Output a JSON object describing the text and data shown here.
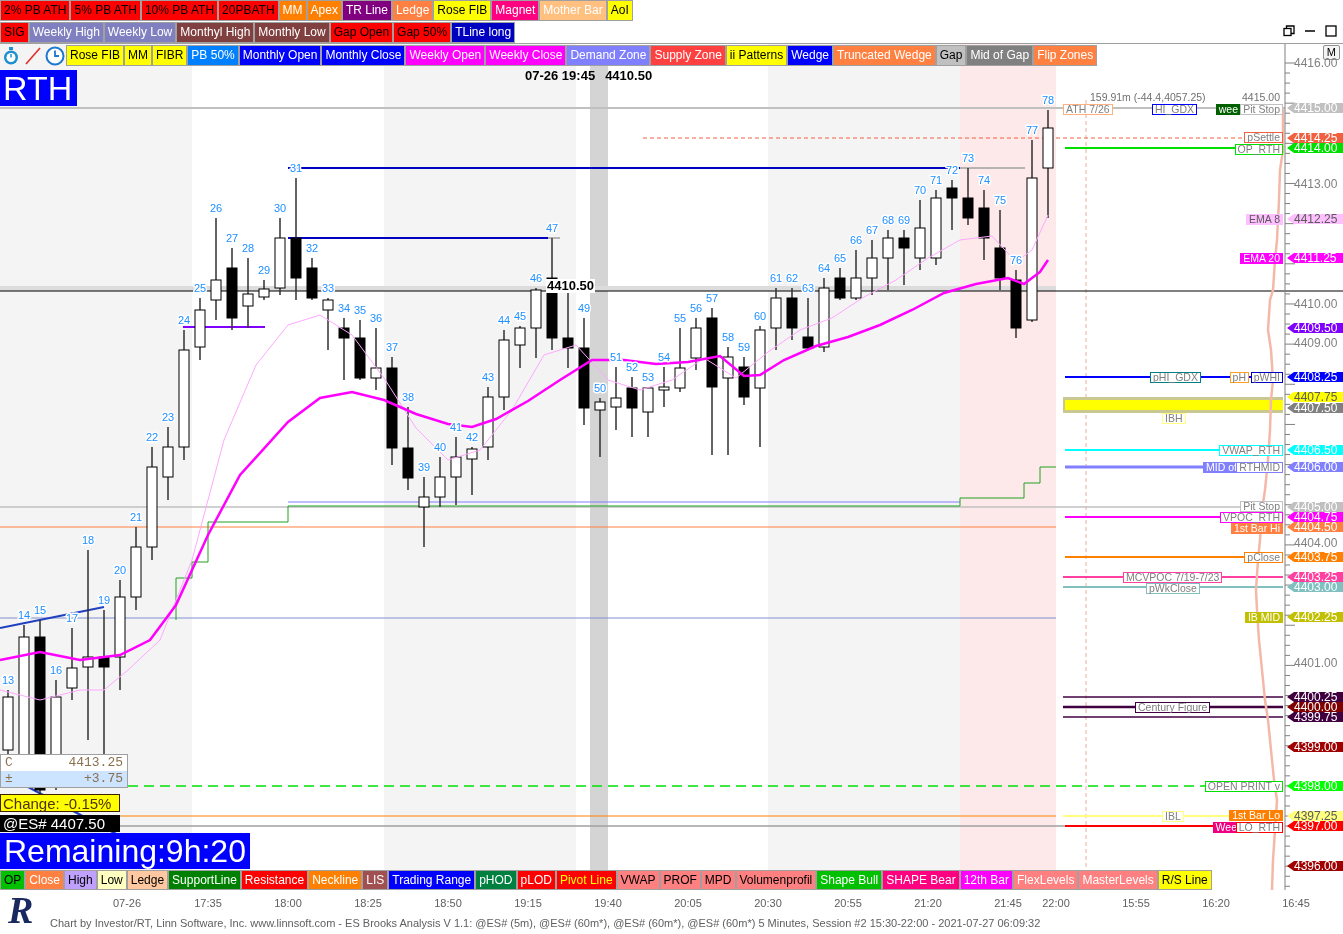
{
  "toolbar_rows": [
    {
      "buttons": [
        {
          "label": "2% PB ATH",
          "color": "#ff0000",
          "kind": "dark"
        },
        {
          "label": "5% PB ATH",
          "color": "#ff0000",
          "kind": "dark"
        },
        {
          "label": "10% PB ATH",
          "color": "#ff0000",
          "kind": "dark"
        },
        {
          "label": "20PBATH",
          "color": "#ff0000",
          "kind": "dark"
        },
        {
          "label": "MM",
          "color": "#ff8000",
          "kind": "light"
        },
        {
          "label": "Apex",
          "color": "#ff8000",
          "kind": "light"
        },
        {
          "label": "TR Line",
          "color": "#800080",
          "kind": "light"
        },
        {
          "label": "Ledge",
          "color": "#ff8040",
          "kind": "light"
        },
        {
          "label": "Rose FIB",
          "color": "#ffff00",
          "kind": "dark"
        },
        {
          "label": "Magnet",
          "color": "#ff0080",
          "kind": "light"
        },
        {
          "label": "Mother Bar",
          "color": "#ffc080",
          "kind": "light"
        },
        {
          "label": "AoI",
          "color": "#ffff00",
          "kind": "dark"
        }
      ]
    },
    {
      "buttons": [
        {
          "label": "SIG",
          "color": "#ff0000",
          "kind": "dark"
        },
        {
          "label": "Weekly High",
          "color": "#8080c0",
          "kind": "light"
        },
        {
          "label": "Weekly Low",
          "color": "#8080c0",
          "kind": "light"
        },
        {
          "label": "Monthyl High",
          "color": "#804040",
          "kind": "light"
        },
        {
          "label": "Monthly Low",
          "color": "#804040",
          "kind": "light"
        },
        {
          "label": "Gap Open",
          "color": "#ff0000",
          "kind": "dark"
        },
        {
          "label": "Gap 50%",
          "color": "#ff0000",
          "kind": "dark"
        },
        {
          "label": "TLine long",
          "color": "#0000c0",
          "kind": "light"
        }
      ]
    }
  ],
  "chart": {
    "tools": [
      {
        "label": "Rose FIB",
        "color": "#ffff00",
        "kind": "dark"
      },
      {
        "label": "MM",
        "color": "#ffff00",
        "kind": "dark"
      },
      {
        "label": "FIBR",
        "color": "#ffff00",
        "kind": "dark"
      },
      {
        "label": "PB 50%",
        "color": "#0080ff",
        "kind": "light"
      },
      {
        "label": "Monthly Open",
        "color": "#0000ff",
        "kind": "light"
      },
      {
        "label": "Monthly Close",
        "color": "#0000ff",
        "kind": "light"
      },
      {
        "label": "Weekly Open",
        "color": "#ff00ff",
        "kind": "light"
      },
      {
        "label": "Weekly Close",
        "color": "#ff00ff",
        "kind": "light"
      },
      {
        "label": "Demand Zone",
        "color": "#8080ff",
        "kind": "light"
      },
      {
        "label": "Supply Zone",
        "color": "#ff4040",
        "kind": "light"
      },
      {
        "label": "ii Patterns",
        "color": "#ffff00",
        "kind": "dark"
      },
      {
        "label": "Wedge",
        "color": "#0000ff",
        "kind": "light"
      },
      {
        "label": "Truncated Wedge",
        "color": "#ff8040",
        "kind": "light"
      },
      {
        "label": "Gap",
        "color": "#c0c0c0",
        "kind": "dark"
      },
      {
        "label": "Mid of Gap",
        "color": "#808080",
        "kind": "light"
      },
      {
        "label": "Flip Zones",
        "color": "#ff8040",
        "kind": "light"
      }
    ],
    "menu_button": "M",
    "session_label": "RTH",
    "cursor_readout": {
      "time": "07-26 19:45",
      "price": "4410.50"
    },
    "cursor_price": "4410.50",
    "bar_numbers": [
      "13",
      "14",
      "15",
      "16",
      "17",
      "18",
      "19",
      "20",
      "21",
      "22",
      "23",
      "24",
      "25",
      "26",
      "27",
      "28",
      "29",
      "30",
      "31",
      "32",
      "33",
      "34",
      "35",
      "36",
      "37",
      "38",
      "39",
      "40",
      "41",
      "42",
      "43",
      "44",
      "45",
      "46",
      "47",
      "49",
      "50",
      "51",
      "52",
      "53",
      "54",
      "55",
      "56",
      "57",
      "58",
      "59",
      "60",
      "61",
      "62",
      "63",
      "64",
      "65",
      "66",
      "67",
      "68",
      "69",
      "70",
      "71",
      "72",
      "73",
      "74",
      "75",
      "76",
      "77",
      "78"
    ],
    "level_labels": [
      {
        "text": "159.91m (-44.4,4057.25)",
        "kind": "note"
      },
      {
        "text": "4415.00",
        "kind": "note"
      },
      {
        "text": "ATH 7/26",
        "kind": "outlined",
        "color": "#ffb080"
      },
      {
        "text": "HI_GDX",
        "kind": "outlined",
        "color": "#0000ff"
      },
      {
        "text": "wee",
        "kind": "filled",
        "color": "#006000"
      },
      {
        "text": "Pit Stop",
        "kind": "outlined",
        "color": "#c0c0c0"
      },
      {
        "text": "pSettle",
        "kind": "outlined",
        "color": "#f06040"
      },
      {
        "text": "OP_RTH",
        "kind": "outlined",
        "color": "#00e000"
      },
      {
        "text": "EMA 8",
        "kind": "filled",
        "color": "#ffc0ff"
      },
      {
        "text": "EMA 20",
        "kind": "filled",
        "color": "#ff00ff"
      },
      {
        "text": "pHI_GDX",
        "kind": "outlined",
        "color": "#008080"
      },
      {
        "text": "pH",
        "kind": "outlined",
        "color": "#ffa020"
      },
      {
        "text": "pWHI",
        "kind": "outlined",
        "color": "#0000c0"
      },
      {
        "text": "IBH",
        "kind": "outlined",
        "color": "#ffff80"
      },
      {
        "text": "VWAP_RTH",
        "kind": "outlined",
        "color": "#00ffff"
      },
      {
        "text": "MID of",
        "kind": "filled",
        "color": "#8080ff"
      },
      {
        "text": "RTHMID",
        "kind": "outlined",
        "color": "#8080ff"
      },
      {
        "text": "Pit Stop",
        "kind": "outlined",
        "color": "#c0c0c0"
      },
      {
        "text": "VPOC_RTH",
        "kind": "outlined",
        "color": "#ff00ff"
      },
      {
        "text": "1st Bar Hi",
        "kind": "filled",
        "color": "#ff8040"
      },
      {
        "text": "pClose",
        "kind": "outlined",
        "color": "#ff8000"
      },
      {
        "text": "MCVPOC 7/19-7/23",
        "kind": "outlined",
        "color": "#ff40a0"
      },
      {
        "text": "pWkClose",
        "kind": "outlined",
        "color": "#80c0c0"
      },
      {
        "text": "IB MID",
        "kind": "filled",
        "color": "#c0c000"
      },
      {
        "text": "Century Figure",
        "kind": "outlined",
        "color": "#400040"
      },
      {
        "text": "OPEN PRINT v",
        "kind": "outlined",
        "color": "#00e000"
      },
      {
        "text": "IBL",
        "kind": "outlined",
        "color": "#ffff80"
      },
      {
        "text": "1st Bar Lo",
        "kind": "filled",
        "color": "#ff8000"
      },
      {
        "text": "Wee",
        "kind": "filled",
        "color": "#f00080"
      },
      {
        "text": "LO_RTH",
        "kind": "outlined",
        "color": "#ff0000"
      }
    ],
    "axis_ticks": [
      "4416.00",
      "4413.00",
      "4410.00",
      "4409.00",
      "4404.00",
      "4401.00"
    ],
    "price_tags": [
      {
        "price": "4415.00",
        "color": "#c0c0c0"
      },
      {
        "price": "4414.25",
        "color": "#f06040"
      },
      {
        "price": "4414.00",
        "color": "#00e000"
      },
      {
        "price": "4412.25",
        "color": "#ffc0ff"
      },
      {
        "price": "4411.25",
        "color": "#ff00ff"
      },
      {
        "price": "4409.50",
        "color": "#8000ff"
      },
      {
        "price": "4408.25",
        "color": "#0000ff"
      },
      {
        "price": "4407.75",
        "color": "#ffff00"
      },
      {
        "price": "4407.50",
        "color": "#808080"
      },
      {
        "price": "4406.50",
        "color": "#00ffff"
      },
      {
        "price": "4406.00",
        "color": "#8080ff"
      },
      {
        "price": "4405.00",
        "color": "#c0c0c0"
      },
      {
        "price": "4404.75",
        "color": "#ff00ff"
      },
      {
        "price": "4404.50",
        "color": "#ff8040"
      },
      {
        "price": "4403.75",
        "color": "#ff8000"
      },
      {
        "price": "4403.25",
        "color": "#ff40a0"
      },
      {
        "price": "4403.00",
        "color": "#80c0c0"
      },
      {
        "price": "4402.25",
        "color": "#c0c000"
      },
      {
        "price": "4400.25",
        "color": "#400040"
      },
      {
        "price": "4400.00",
        "color": "#800000"
      },
      {
        "price": "4399.75",
        "color": "#400040"
      },
      {
        "price": "4399.00",
        "color": "#a00000"
      },
      {
        "price": "4398.00",
        "color": "#00ff00"
      },
      {
        "price": "4397.25",
        "color": "#ffff80"
      },
      {
        "price": "4397.00",
        "color": "#ff0000"
      },
      {
        "price": "4396.00",
        "color": "#a00000"
      }
    ],
    "quote_box": [
      {
        "label": "C",
        "value": "4413.25",
        "selected": false
      },
      {
        "label": "±",
        "value": "+3.75",
        "selected": true
      }
    ],
    "change": "Change: -0.15%",
    "last_price": "@ES# 4407.50",
    "remaining": "Remaining:9h:20",
    "bottom_tools": [
      {
        "label": "OP",
        "color": "#00c000",
        "kind": "dark"
      },
      {
        "label": "Close",
        "color": "#ff8040",
        "kind": "light"
      },
      {
        "label": "High",
        "color": "#c0a0ff",
        "kind": "dark"
      },
      {
        "label": "Low",
        "color": "#ffffc0",
        "kind": "dark"
      },
      {
        "label": "Ledge",
        "color": "#ffc8a0",
        "kind": "dark"
      },
      {
        "label": "SupportLine",
        "color": "#008000",
        "kind": "light"
      },
      {
        "label": "Resistance",
        "color": "#ff0000",
        "kind": "light"
      },
      {
        "label": "Neckline",
        "color": "#ff8000",
        "kind": "light"
      },
      {
        "label": "LIS",
        "color": "#a05050",
        "kind": "light"
      },
      {
        "label": "Trading Range",
        "color": "#0000ff",
        "kind": "light"
      },
      {
        "label": "pHOD",
        "color": "#008040",
        "kind": "light"
      },
      {
        "label": "pLOD",
        "color": "#ff0000",
        "kind": "light"
      },
      {
        "label": "Pivot Line",
        "color": "#ff0000",
        "kind": "accent"
      },
      {
        "label": "VWAP",
        "color": "#ff8080",
        "kind": "dark"
      },
      {
        "label": "PROF",
        "color": "#ff8080",
        "kind": "dark"
      },
      {
        "label": "MPD",
        "color": "#ff8080",
        "kind": "dark"
      },
      {
        "label": "Volumenprofil",
        "color": "#ff8080",
        "kind": "dark"
      },
      {
        "label": "Shape Bull",
        "color": "#00c000",
        "kind": "light"
      },
      {
        "label": "SHAPE Bear",
        "color": "#ff0080",
        "kind": "light"
      },
      {
        "label": "12th Bar",
        "color": "#ff00ff",
        "kind": "light"
      },
      {
        "label": "FlexLevels",
        "color": "#ff8080",
        "kind": "light"
      },
      {
        "label": "MasterLevels",
        "color": "#ff8080",
        "kind": "light"
      },
      {
        "label": "R/S Line",
        "color": "#ffff00",
        "kind": "dark"
      }
    ]
  },
  "time_axis": [
    "07-26",
    "17:35",
    "18:00",
    "18:25",
    "18:50",
    "19:15",
    "19:40",
    "20:05",
    "20:30",
    "20:55",
    "21:20",
    "21:45",
    "22:00",
    "15:55",
    "16:20",
    "16:45"
  ],
  "logo": "R",
  "footer": "Chart by Investor/RT, Linn Software, Inc. www.linnsoft.com - ES Brooks Analysis V 1.1: @ES# (5m), @ES# (60m*), @ES# (60m*), @ES# (60m*) 5 Minutes, Session #2 15:30-22:00 - 2021-07-27 06:09:32"
}
